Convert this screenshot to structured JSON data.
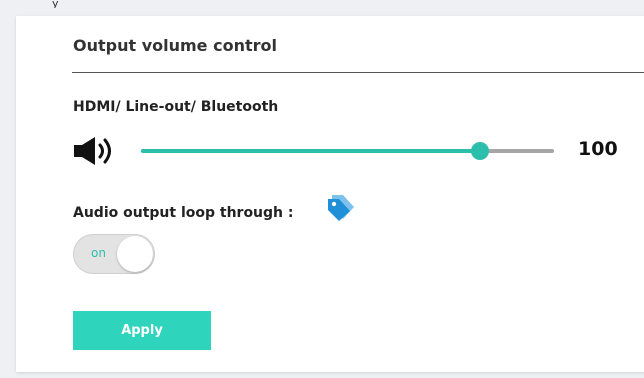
{
  "page": {
    "top_stub_text": "y",
    "background_color": "#eef0f3"
  },
  "output_volume": {
    "title": "Output volume control",
    "source_label": "HDMI/ Line-out/ Bluetooth",
    "speaker_icon": "speaker-volume-icon",
    "volume": {
      "value": 100,
      "display": "100",
      "slider_fill_fraction": 0.82
    },
    "accent_color": "#2bbfab"
  },
  "loop_through": {
    "label": "Audio output loop through :",
    "tag_icon": "price-tag-icon",
    "tag_color": "#1f8fd8",
    "toggle": {
      "state": "on",
      "text": "on"
    }
  },
  "actions": {
    "apply_label": "Apply",
    "apply_color": "#2fd4bd"
  }
}
